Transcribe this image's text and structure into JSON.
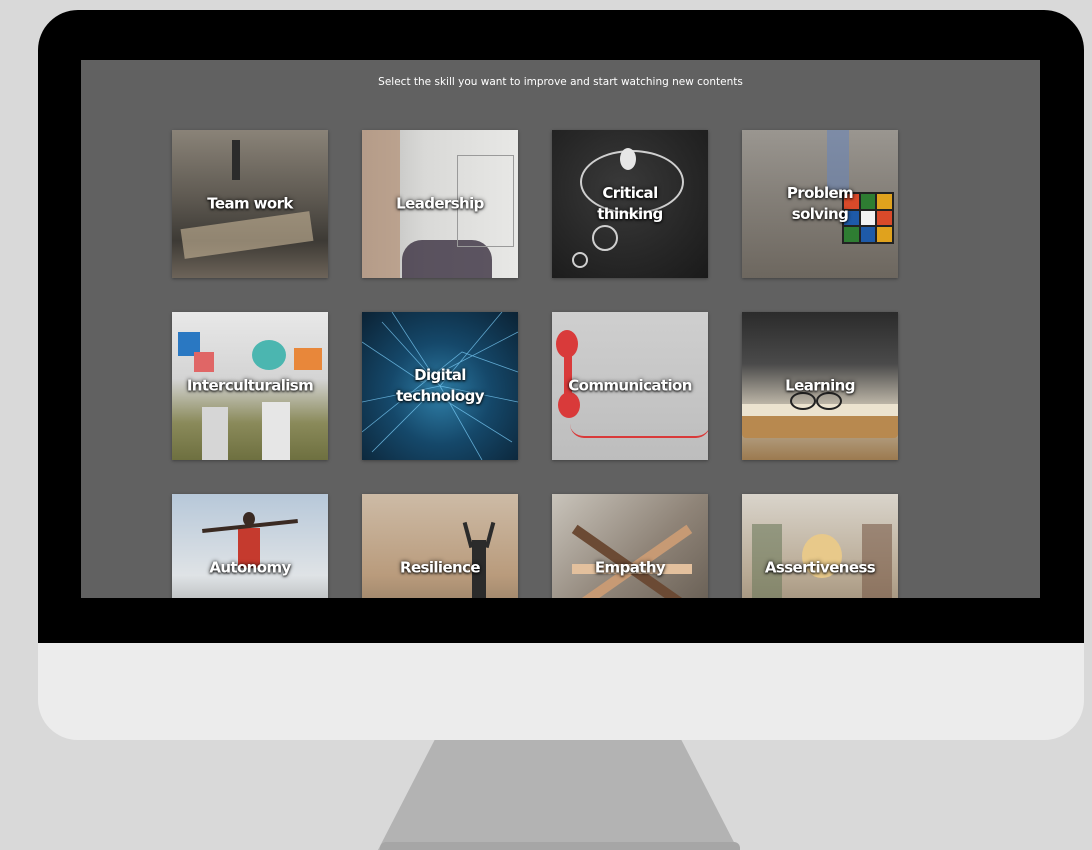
{
  "page": {
    "prompt": "Select the skill you want to improve and start watching new contents"
  },
  "skills": [
    {
      "label": "Team work"
    },
    {
      "label": "Leadership"
    },
    {
      "label": "Critical\nthinking"
    },
    {
      "label": "Problem\nsolving"
    },
    {
      "label": "Interculturalism"
    },
    {
      "label": "Digital\ntechnology"
    },
    {
      "label": "Communication"
    },
    {
      "label": "Learning"
    },
    {
      "label": "Autonomy"
    },
    {
      "label": "Resilience"
    },
    {
      "label": "Empathy"
    },
    {
      "label": "Assertiveness"
    }
  ],
  "colors": {
    "screen_background": "#616161",
    "bezel": "#000000",
    "chin": "#ececec",
    "stand": "#b3b3b3",
    "page_background": "#d9d9d9"
  }
}
